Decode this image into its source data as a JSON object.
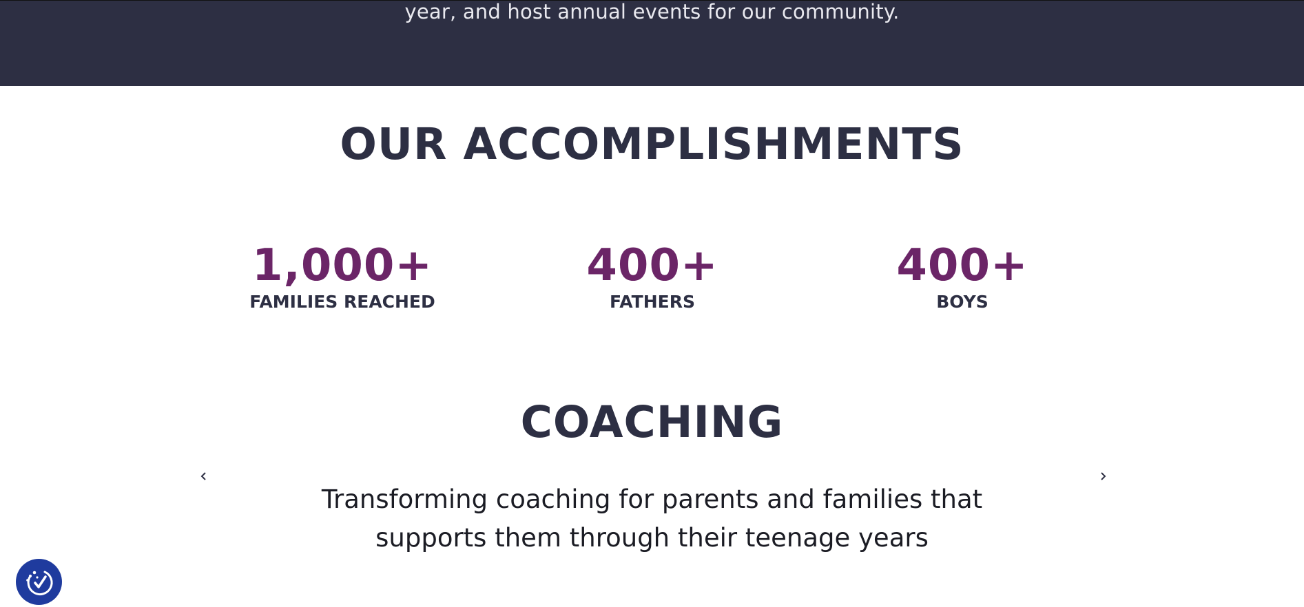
{
  "intro": {
    "text": "year, and host annual events for our community."
  },
  "accomplishments": {
    "title": "OUR ACCOMPLISHMENTS",
    "stats": [
      {
        "value": "1,000+",
        "label": "FAMILIES REACHED"
      },
      {
        "value": "400+",
        "label": "FATHERS"
      },
      {
        "value": "400+",
        "label": "BOYS"
      }
    ]
  },
  "coaching": {
    "title": "COACHING",
    "prev_icon": "chevron-left-icon",
    "next_icon": "chevron-right-icon",
    "lines": [
      "Transforming coaching for parents and families that",
      "supports them through their teenage years"
    ]
  },
  "accessibility": {
    "icon": "accessibility-icon"
  },
  "colors": {
    "band": "#2d2f43",
    "accent": "#6b2567",
    "heading": "#2d2f43",
    "access_button": "#1f3b9e"
  }
}
